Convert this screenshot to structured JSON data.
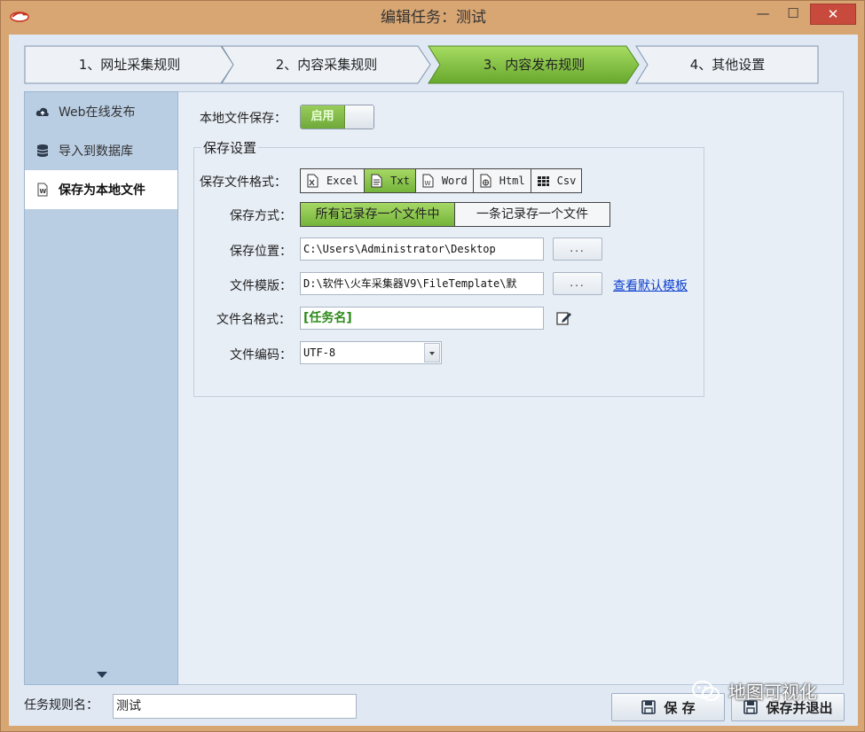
{
  "window": {
    "title": "编辑任务：测试",
    "min_glyph": "—",
    "max_glyph": "☐",
    "close_glyph": "✕"
  },
  "steps": [
    {
      "label": "1、网址采集规则",
      "active": false
    },
    {
      "label": "2、内容采集规则",
      "active": false
    },
    {
      "label": "3、内容发布规则",
      "active": true
    },
    {
      "label": "4、其他设置",
      "active": false
    }
  ],
  "sidebar": {
    "items": [
      {
        "label": "Web在线发布",
        "icon": "cloud-upload-icon",
        "active": false
      },
      {
        "label": "导入到数据库",
        "icon": "database-icon",
        "active": false
      },
      {
        "label": "保存为本地文件",
        "icon": "word-file-icon",
        "active": true
      }
    ]
  },
  "form": {
    "local_save_label": "本地文件保存：",
    "local_save_toggle": "启用",
    "group_title": "保存设置",
    "format_label": "保存文件格式：",
    "formats": [
      {
        "label": "Excel",
        "icon": "excel-icon",
        "selected": false
      },
      {
        "label": "Txt",
        "icon": "txt-icon",
        "selected": true
      },
      {
        "label": "Word",
        "icon": "word-icon",
        "selected": false
      },
      {
        "label": "Html",
        "icon": "html-icon",
        "selected": false
      },
      {
        "label": "Csv",
        "icon": "csv-icon",
        "selected": false
      }
    ],
    "mode_label": "保存方式：",
    "modes": [
      "所有记录存一个文件中",
      "一条记录存一个文件"
    ],
    "location_label": "保存位置：",
    "location_value": "C:\\Users\\Administrator\\Desktop",
    "browse_label": "...",
    "template_label": "文件模版：",
    "template_value": "D:\\软件\\火车采集器V9\\FileTemplate\\默",
    "template_browse_label": "...",
    "view_default_template": "查看默认模板",
    "filename_label": "文件名格式：",
    "filename_value": "[任务名]",
    "encoding_label": "文件编码：",
    "encoding_value": "UTF-8"
  },
  "footer": {
    "task_name_label": "任务规则名：",
    "task_name_value": "测试",
    "save_label": "保 存",
    "save_exit_label": "保存并退出"
  },
  "watermark": {
    "text": "地图可视化"
  },
  "colors": {
    "window_frame": "#d8a673",
    "active_step": "#7cbb3e",
    "selected_button": "#8cc751",
    "close_button": "#c84a3c",
    "link": "#0b3fce",
    "filename_text": "#2e8b1a"
  }
}
